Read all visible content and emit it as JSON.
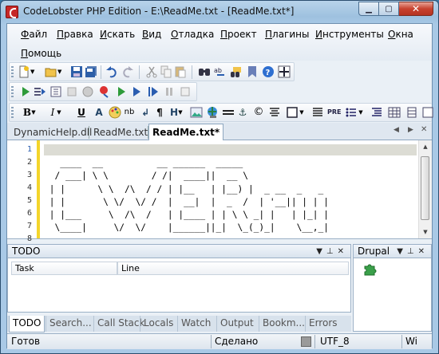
{
  "window": {
    "title": "CodeLobster PHP Edition - E:\\ReadMe.txt - [ReadMe.txt*]",
    "minimize_glyph": "▁",
    "maximize_glyph": "▢",
    "close_glyph": "✕"
  },
  "menu": [
    {
      "label": "Файл"
    },
    {
      "label": "Правка"
    },
    {
      "label": "Искать"
    },
    {
      "label": "Вид"
    },
    {
      "label": "Отладка"
    },
    {
      "label": "Проект"
    },
    {
      "label": "Плагины"
    },
    {
      "label": "Инструменты"
    },
    {
      "label": "Окна"
    },
    {
      "label": "Помощь"
    }
  ],
  "toolbar_format": {
    "bold": "B",
    "italic": "I",
    "underline": "U",
    "font": "A",
    "nbsp": "nb",
    "paragraph": "¶",
    "heading": "H",
    "pre": "PRE"
  },
  "tabs": [
    {
      "label": "DynamicHelp.dll"
    },
    {
      "label": "ReadMe.txt"
    },
    {
      "label": "ReadMe.txt*"
    }
  ],
  "editor": {
    "line_numbers": [
      "1",
      "2",
      "3",
      "4",
      "5",
      "6",
      "7",
      "8"
    ],
    "lines": [
      "",
      "   ____  __          __ ______  _____                ",
      "  / ___| \\ \\        / /|  ____||  __ \\               ",
      " | |      \\ \\  /\\  / / | |__   | |__) |  _ __  _   _ ",
      " | |       \\ \\/  \\/ /  |  __|  |  _  /  | '__|| | | |",
      " | |___     \\  /\\  /   | |____ | | \\ \\ _| |   | |_| |",
      "  \\____|     \\/  \\/    |______||_|  \\_(_)_|    \\__,_|",
      ""
    ]
  },
  "todo_panel": {
    "title": "TODO",
    "columns": [
      "Task",
      "Line"
    ]
  },
  "drupal_panel": {
    "title": "Drupal"
  },
  "bottom_tabs": [
    {
      "label": "TODO"
    },
    {
      "label": "Search..."
    },
    {
      "label": "Call Stack"
    },
    {
      "label": "Locals"
    },
    {
      "label": "Watch"
    },
    {
      "label": "Output"
    },
    {
      "label": "Bookm..."
    },
    {
      "label": "Errors"
    }
  ],
  "status": {
    "left": "Готов",
    "middle": "Сделано",
    "encoding": "UTF_8",
    "eol": "Wi"
  },
  "colors": {
    "titlebar": "#a9c9e6",
    "close_button": "#c8422f",
    "current_line": "#dcdcd4",
    "gutter_marker": "#f4d52b",
    "drupal_icon": "#3aa04a"
  },
  "icons": {
    "app": "codelobster-logo-icon",
    "drupal": "drupal-puzzle-icon"
  }
}
